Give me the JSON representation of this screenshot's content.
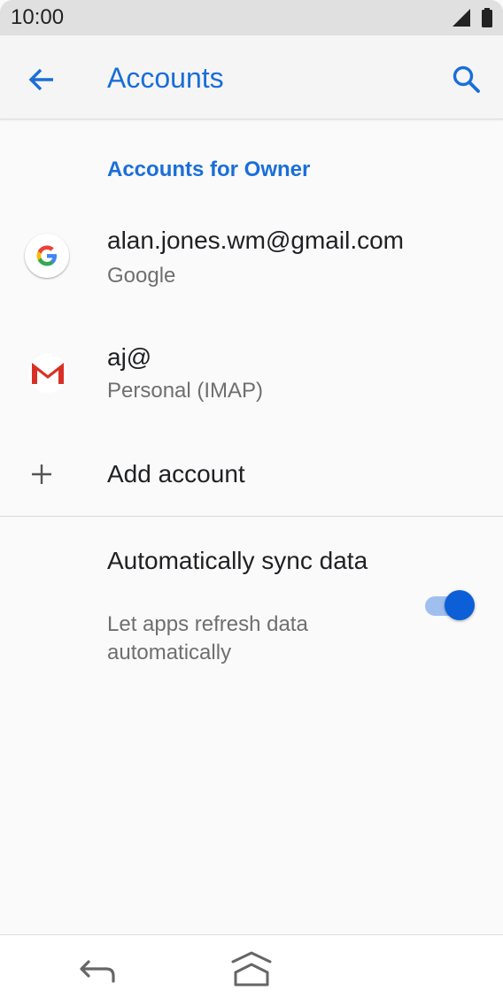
{
  "status_bar": {
    "time": "10:00",
    "icons": [
      "signal-icon",
      "battery-icon"
    ]
  },
  "app_bar": {
    "title": "Accounts",
    "back_icon": "arrow-back-icon",
    "search_icon": "search-icon"
  },
  "section": {
    "header": "Accounts for Owner"
  },
  "accounts": [
    {
      "title": "alan.jones.wm@gmail.com",
      "subtitle": "Google",
      "icon": "google-icon"
    },
    {
      "title": "aj@",
      "subtitle": "Personal (IMAP)",
      "icon": "gmail-icon"
    }
  ],
  "add_account": {
    "label": "Add account",
    "icon": "plus-icon"
  },
  "sync": {
    "title": "Automatically sync data",
    "subtitle": "Let apps refresh data automatically",
    "enabled": true
  },
  "colors": {
    "accent": "#1a6ed8",
    "toggle_thumb": "#0d5fd8",
    "toggle_track": "#9fc0ee"
  },
  "nav_bar": {
    "icons": [
      "nav-back-icon",
      "nav-home-icon"
    ]
  }
}
